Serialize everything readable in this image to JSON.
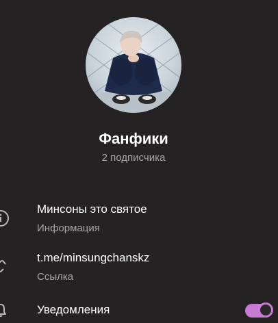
{
  "profile": {
    "name": "Фанфики",
    "subscribers": "2 подписчика"
  },
  "info": {
    "description": "Минсоны это святое",
    "description_label": "Информация",
    "link": "t.me/minsungchanskz",
    "link_label": "Ссылка",
    "notifications_label": "Уведомления",
    "notifications_enabled": true
  },
  "colors": {
    "background": "#252224",
    "accent": "#c77ad3",
    "secondary_text": "#a9a5a8"
  },
  "icons": [
    "info-icon",
    "link-icon",
    "bell-icon",
    "avatar-photo"
  ]
}
